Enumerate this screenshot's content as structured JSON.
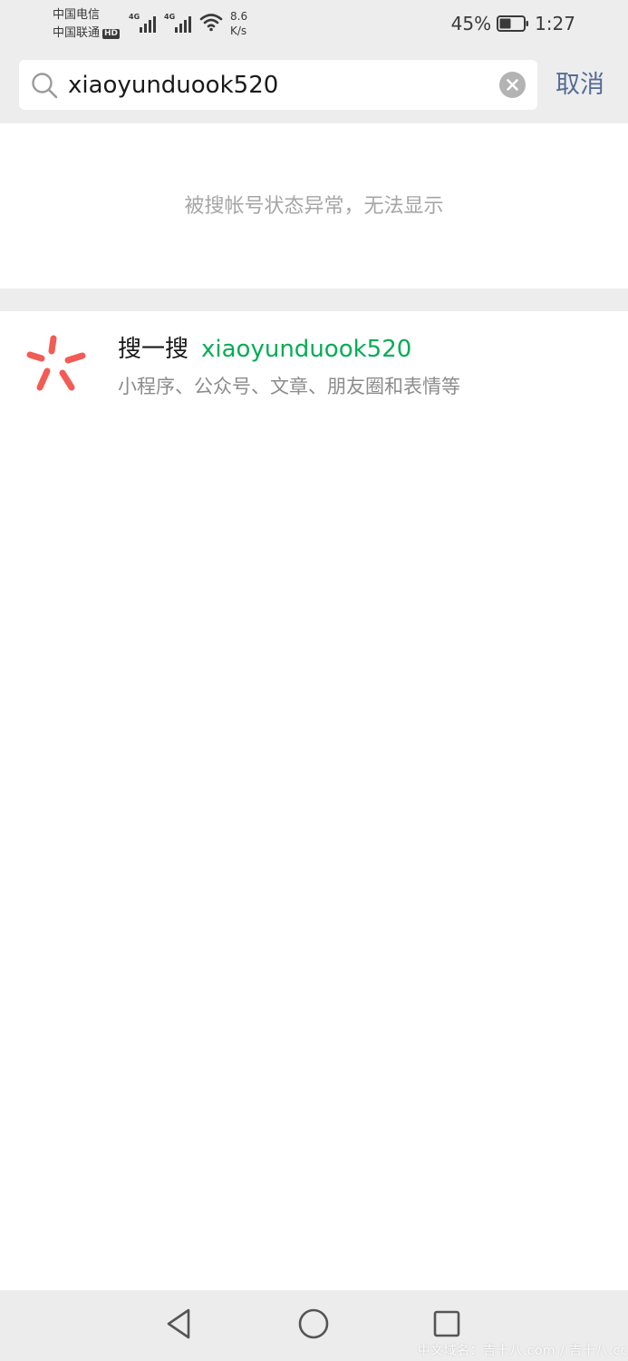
{
  "status_bar": {
    "carrier_1": "中国电信",
    "carrier_2": "中国联通",
    "hd_badge": "HD",
    "network_type_1": "4G",
    "network_type_2": "4G",
    "net_speed_value": "8.6",
    "net_speed_unit": "K/s",
    "battery_percent": "45%",
    "time": "1:27"
  },
  "search": {
    "value": "xiaoyunduook520",
    "cancel_label": "取消"
  },
  "notice": {
    "text": "被搜帐号状态异常，无法显示"
  },
  "sousou": {
    "title": "搜一搜",
    "query": "xiaoyunduook520",
    "description": "小程序、公众号、文章、朋友圈和表情等",
    "icon": "sousou-icon",
    "icon_color": "#f25c54"
  },
  "nav_bar": {
    "back_icon": "back-triangle-icon",
    "home_icon": "home-circle-icon",
    "recent_icon": "recent-square-icon"
  },
  "watermark": "中文域名：吉十八.com / 吉十八.cc",
  "colors": {
    "link_blue": "#576b95",
    "wechat_green": "#06ad56",
    "background_gray": "#ededed"
  }
}
